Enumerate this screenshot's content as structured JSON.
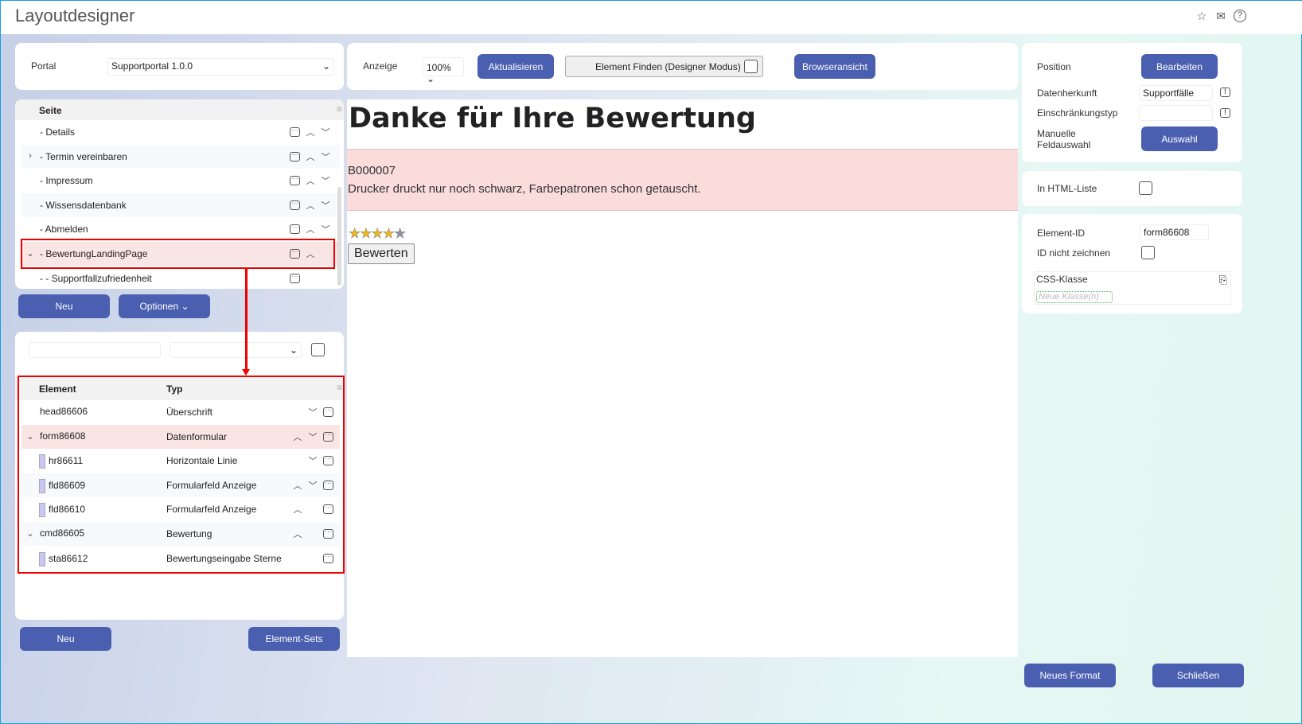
{
  "app": {
    "title": "Layoutdesigner",
    "icons": [
      "star-icon",
      "mail-icon",
      "help-icon"
    ]
  },
  "portal": {
    "label": "Portal",
    "value": "Supportportal 1.0.0"
  },
  "pages": {
    "header": "Seite",
    "items": [
      {
        "label": "- Details",
        "expander": "",
        "up": true,
        "down": true
      },
      {
        "label": "- Termin vereinbaren",
        "expander": "›",
        "up": true,
        "down": true
      },
      {
        "label": "- Impressum",
        "expander": "",
        "up": true,
        "down": true
      },
      {
        "label": "- Wissensdatenbank",
        "expander": "",
        "up": true,
        "down": true
      },
      {
        "label": "- Abmelden",
        "expander": "",
        "up": true,
        "down": true
      },
      {
        "label": "- BewertungLandingPage",
        "expander": "⌄",
        "up": true,
        "down": false
      },
      {
        "label": "- - Supportfallzufriedenheit",
        "expander": "",
        "up": false,
        "down": false
      }
    ]
  },
  "page_buttons": {
    "new": "Neu",
    "options": "Optionen ⌄"
  },
  "elements": {
    "col_element": "Element",
    "col_type": "Typ",
    "rows": [
      {
        "id": "head86606",
        "type": "Überschrift",
        "expander": "",
        "marker": false,
        "up": false,
        "down": true
      },
      {
        "id": "form86608",
        "type": "Datenformular",
        "expander": "⌄",
        "marker": false,
        "up": true,
        "down": true
      },
      {
        "id": "hr86611",
        "type": "Horizontale Linie",
        "expander": "",
        "marker": true,
        "up": false,
        "down": true
      },
      {
        "id": "fld86609",
        "type": "Formularfeld Anzeige",
        "expander": "",
        "marker": true,
        "up": true,
        "down": true
      },
      {
        "id": "fld86610",
        "type": "Formularfeld Anzeige",
        "expander": "",
        "marker": true,
        "up": true,
        "down": false
      },
      {
        "id": "cmd86605",
        "type": "Bewertung",
        "expander": "⌄",
        "marker": false,
        "up": true,
        "down": false
      },
      {
        "id": "sta86612",
        "type": "Bewertungseingabe Sterne",
        "expander": "",
        "marker": true,
        "up": false,
        "down": false
      }
    ]
  },
  "bottom_left": {
    "new": "Neu",
    "sets": "Element-Sets"
  },
  "toolbar": {
    "zoom_label": "Anzeige",
    "zoom_value": "100%",
    "refresh": "Aktualisieren",
    "find": "Element Finden (Designer Modus)",
    "browser": "Browseransicht"
  },
  "preview": {
    "heading": "Danke für Ihre Bewertung",
    "case_id": "B000007",
    "case_text": "Drucker druckt nur noch schwarz, Farbepatronen schon getauscht.",
    "rating": 4,
    "rating_max": 5,
    "rate_button": "Bewerten"
  },
  "props": {
    "position_label": "Position",
    "position_button": "Bearbeiten",
    "source_label": "Datenherkunft",
    "source_value": "Supportfälle",
    "restriction_label": "Einschränkungstyp",
    "restriction_value": "",
    "manual_label": "Manuelle Feldauswahl",
    "manual_button": "Auswahl",
    "html_list_label": "In HTML-Liste",
    "element_id_label": "Element-ID",
    "element_id_value": "form86608",
    "no_id_label": "ID nicht zeichnen",
    "css_label": "CSS-Klasse",
    "css_placeholder": "Neue Klasse(n)"
  },
  "footer": {
    "new_format": "Neues Format",
    "close": "Schließen"
  },
  "colors": {
    "accent": "#4a5fb0",
    "highlight": "#f9e5e4",
    "annotation": "#e00000"
  }
}
